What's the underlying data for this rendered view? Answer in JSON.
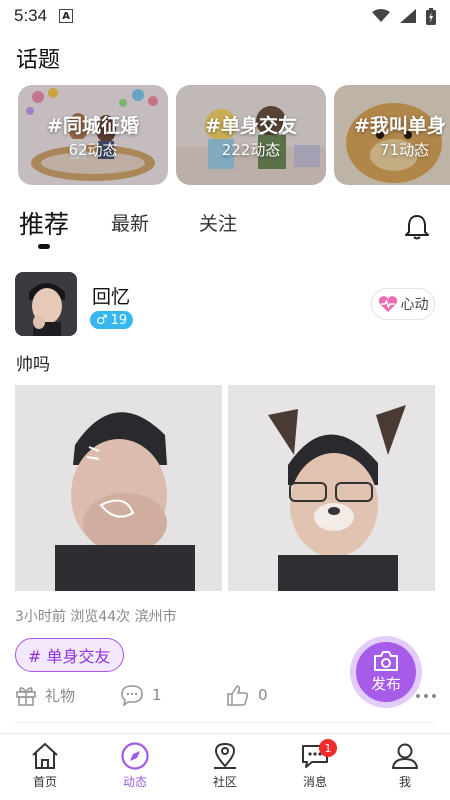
{
  "status_bar": {
    "time": "5:34",
    "notice_letter": "A"
  },
  "topics": {
    "title": "话题",
    "cards": [
      {
        "name": "#同城征婚",
        "count": "62动态"
      },
      {
        "name": "#单身交友",
        "count": "222动态"
      },
      {
        "name": "#我叫单身",
        "count": "71动态"
      }
    ]
  },
  "tabs": [
    "推荐",
    "最新",
    "关注"
  ],
  "post": {
    "username": "回忆",
    "gender_symbol": "♂",
    "age": "19",
    "heart_label": "心动",
    "text": "帅吗",
    "meta": "3小时前 浏览44次 滨州市",
    "tag": "# 单身交友",
    "gift_label": "礼物",
    "comment_count": "1",
    "like_count": "0"
  },
  "fab": {
    "label": "发布"
  },
  "bottom_nav": {
    "items": [
      {
        "label": "首页"
      },
      {
        "label": "动态"
      },
      {
        "label": "社区"
      },
      {
        "label": "消息"
      },
      {
        "label": "我"
      }
    ],
    "message_badge": "1"
  },
  "colors": {
    "accent": "#a65be9",
    "gender_badge": "#37b7f0",
    "badge_red": "#ee2b2b"
  }
}
